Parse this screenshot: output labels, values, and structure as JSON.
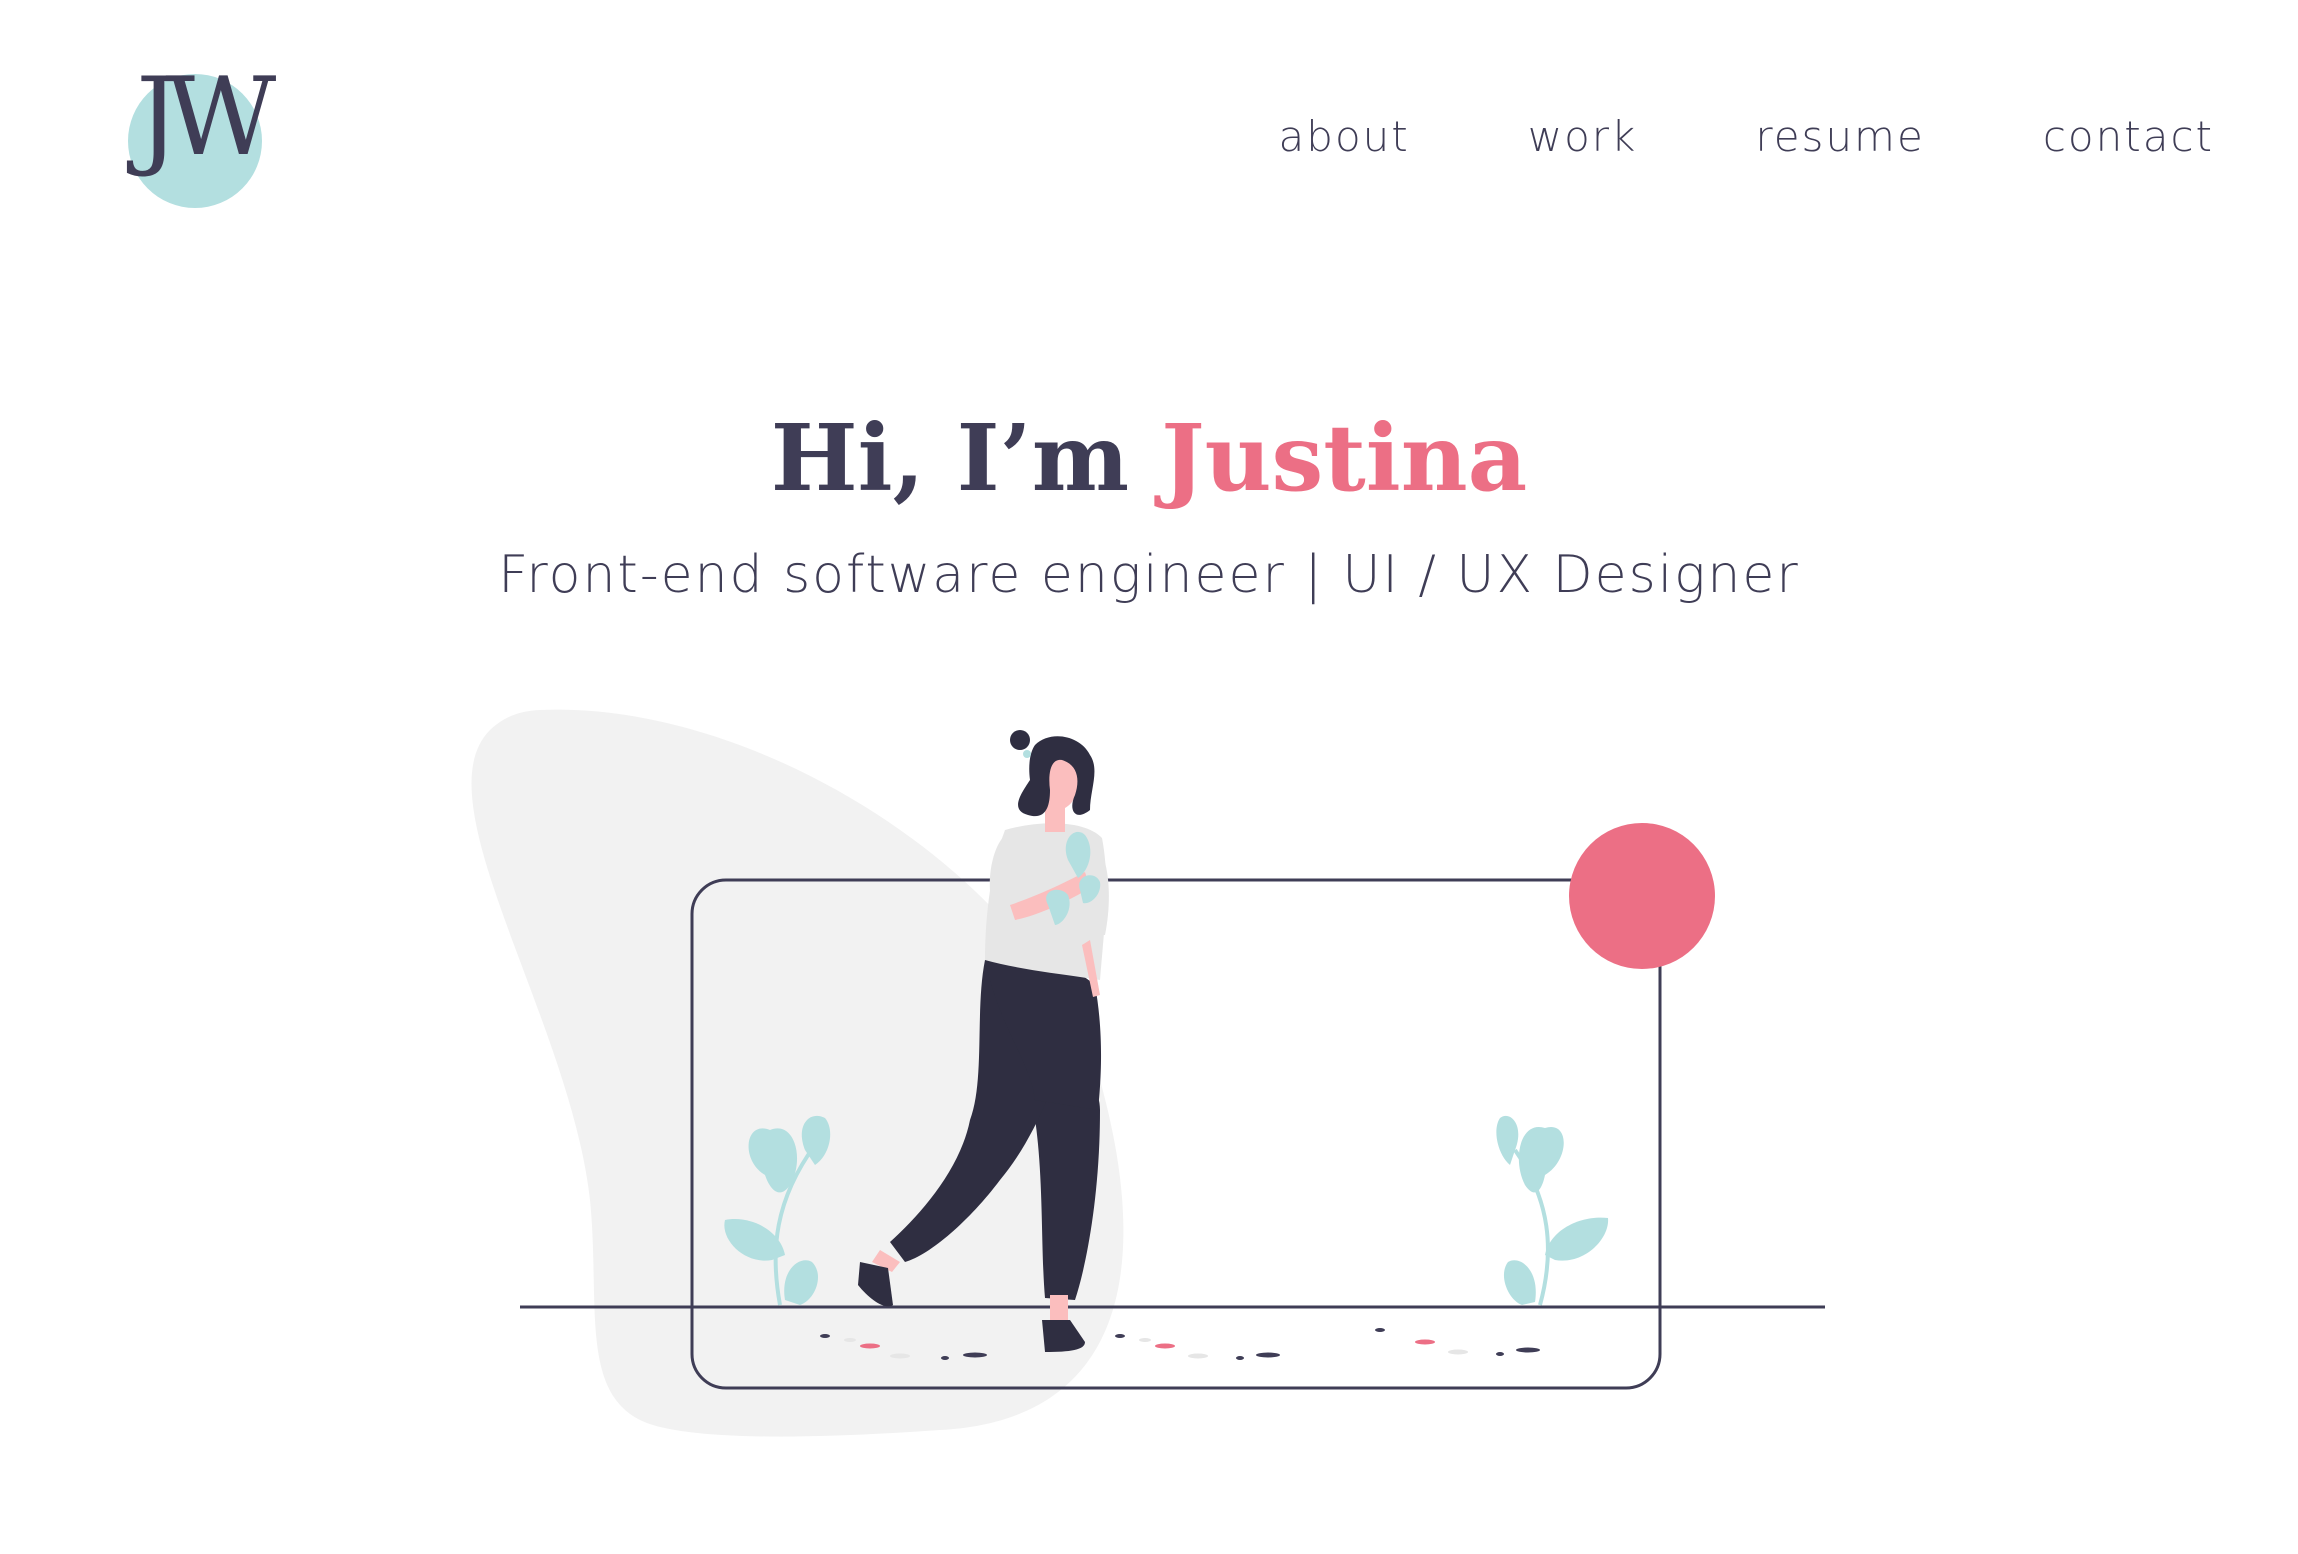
{
  "brand": {
    "logo_text": "JW",
    "logo_circle_color": "#b3dfe0"
  },
  "nav": {
    "items": [
      {
        "label": "about"
      },
      {
        "label": "work"
      },
      {
        "label": "resume"
      },
      {
        "label": "contact"
      }
    ]
  },
  "hero": {
    "greeting": "Hi, I’m ",
    "name": "Justina",
    "subtitle": "Front-end software engineer | UI / UX Designer"
  },
  "colors": {
    "ink": "#3f3d56",
    "accent_pink": "#ec6f85",
    "accent_teal": "#b3dfe0",
    "blob_gray": "#f2f2f2",
    "figure_dark": "#2f2e41",
    "skin": "#fbbebe"
  }
}
